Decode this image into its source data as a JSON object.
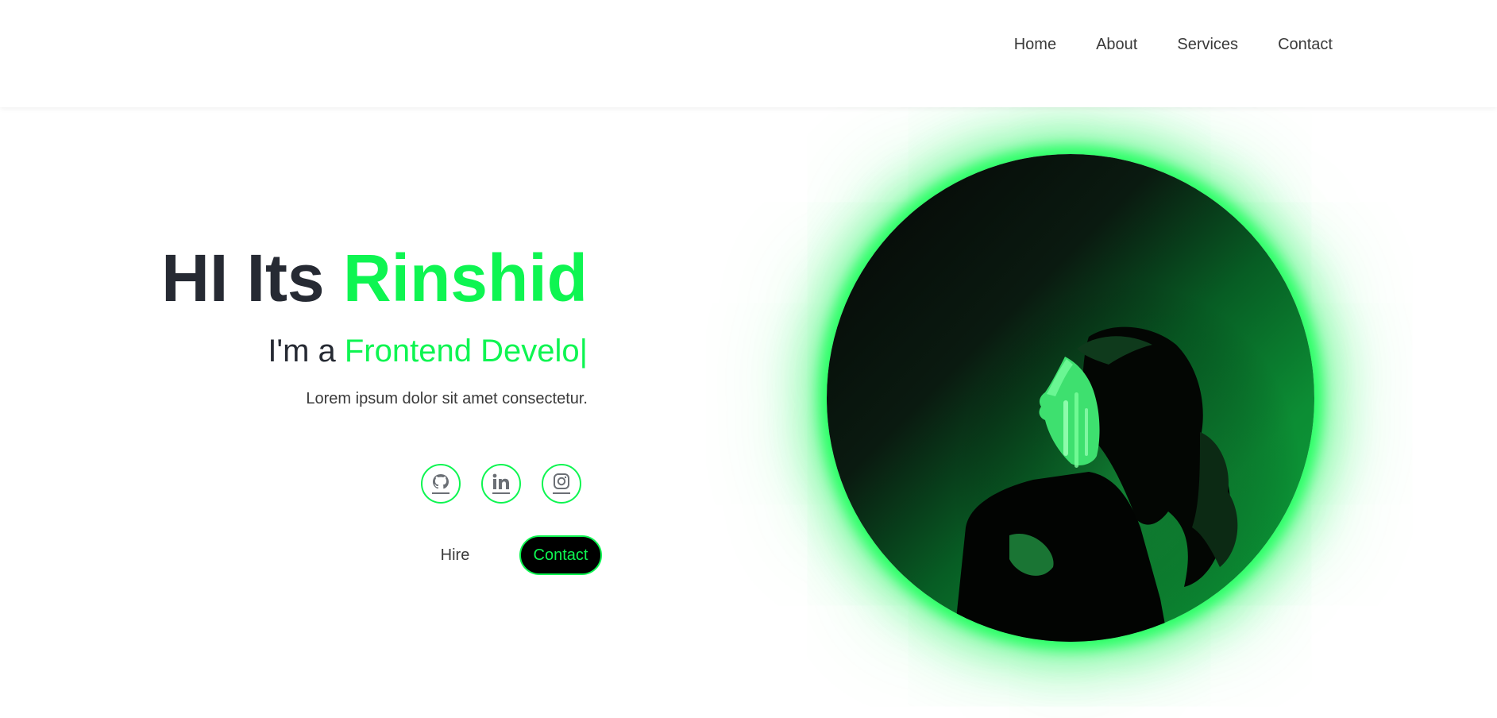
{
  "nav": {
    "links": [
      {
        "label": "Home"
      },
      {
        "label": "About"
      },
      {
        "label": "Services"
      },
      {
        "label": "Contact"
      }
    ]
  },
  "hero": {
    "greeting": "HI Its",
    "name": "Rinshid",
    "sub_prefix": "I'm a",
    "typed_text": "Frontend Develo",
    "cursor": "|",
    "description": "Lorem ipsum dolor sit amet consectetur."
  },
  "socials": [
    {
      "icon": "github-icon"
    },
    {
      "icon": "linkedin-icon"
    },
    {
      "icon": "instagram-icon"
    }
  ],
  "actions": {
    "hire_label": "Hire",
    "contact_label": "Contact"
  },
  "colors": {
    "accent": "#0ef551",
    "text_dark": "#262a33",
    "text": "#3a3a3a"
  }
}
